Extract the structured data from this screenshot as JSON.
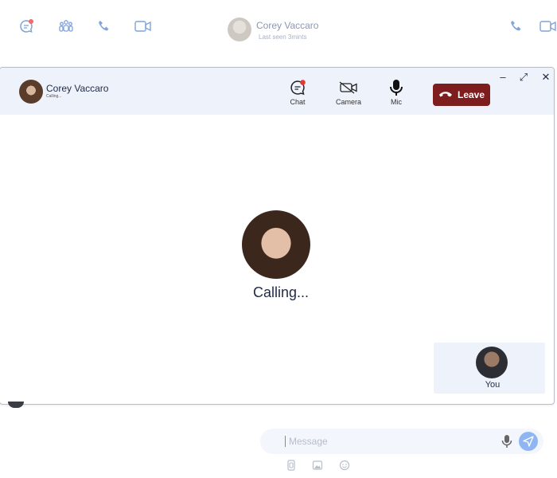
{
  "background": {
    "contact_name": "Corey Vaccaro",
    "contact_status": "Last seen 3mints",
    "icons": [
      "chat-icon",
      "people-icon",
      "phone-icon",
      "video-icon"
    ]
  },
  "call": {
    "contact_name": "Corey Vaccaro",
    "contact_status": "Calling...",
    "controls": {
      "chat": "Chat",
      "camera": "Camera",
      "mic": "Mic",
      "leave": "Leave"
    },
    "window": {
      "minimize": "–",
      "expand": "⤢",
      "close": "✕"
    },
    "calling_text": "Calling...",
    "self_label": "You"
  },
  "composer": {
    "placeholder": "Message"
  },
  "colors": {
    "accent": "#3c78d8",
    "leave": "#7e1d1d",
    "header_bg": "#eef2fb",
    "notification": "#e53935"
  }
}
